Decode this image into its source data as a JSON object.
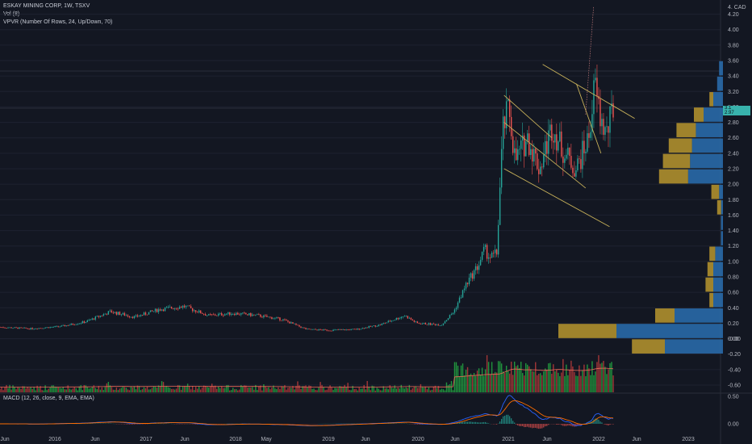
{
  "header": {
    "symbol_line": "ESKAY MINING CORP, 1W, TSXV",
    "vol_line": "Vol (8)",
    "vpvr_line": "VPVR (Number Of Rows, 24, Up/Down, 70)",
    "macd_line": "MACD (12, 26, close, 9, EMA, EMA)",
    "currency_label": "4. CAD"
  },
  "price_tag": {
    "line1": "3.1",
    "line2": "2.97"
  },
  "colors": {
    "background": "#131722",
    "up": "#26a69a",
    "down": "#ef5350",
    "vol_up": "#22a340",
    "vol_down": "#b23a3a",
    "vpvr_up": "#2a6fb0",
    "vpvr_down": "#b8962e",
    "trend": "#c9b25a",
    "macd": "#2962ff",
    "signal": "#ff6d00",
    "hist_up": "#26a69a",
    "hist_down": "#ef5350"
  },
  "chart_data": {
    "type": "candlestick",
    "title": "ESKAY MINING CORP, 1W, TSXV",
    "y_axis": {
      "ticks": [
        "4.20",
        "4.00",
        "3.80",
        "3.60",
        "3.40",
        "3.20",
        "3.00",
        "2.80",
        "2.60",
        "2.40",
        "2.20",
        "2.00",
        "1.80",
        "1.60",
        "1.40",
        "1.20",
        "1.00",
        "0.80",
        "0.60",
        "0.40",
        "0.20",
        "0.00",
        "-0.00",
        "-0.20",
        "-0.40",
        "-0.60"
      ],
      "range": [
        -0.6,
        4.3
      ]
    },
    "x_axis": {
      "ticks": [
        "Jun",
        "2016",
        "Jun",
        "2017",
        "Jun",
        "2018",
        "May",
        "2019",
        "Jun",
        "2020",
        "Jun",
        "2021",
        "Jun",
        "2022",
        "Jun",
        "2023"
      ]
    },
    "price_keyframes": [
      {
        "t": 0.0,
        "p": 0.15
      },
      {
        "t": 0.05,
        "p": 0.13
      },
      {
        "t": 0.1,
        "p": 0.16
      },
      {
        "t": 0.14,
        "p": 0.22
      },
      {
        "t": 0.18,
        "p": 0.35
      },
      {
        "t": 0.22,
        "p": 0.28
      },
      {
        "t": 0.26,
        "p": 0.38
      },
      {
        "t": 0.3,
        "p": 0.42
      },
      {
        "t": 0.34,
        "p": 0.3
      },
      {
        "t": 0.38,
        "p": 0.33
      },
      {
        "t": 0.42,
        "p": 0.3
      },
      {
        "t": 0.46,
        "p": 0.25
      },
      {
        "t": 0.5,
        "p": 0.12
      },
      {
        "t": 0.54,
        "p": 0.11
      },
      {
        "t": 0.58,
        "p": 0.12
      },
      {
        "t": 0.62,
        "p": 0.18
      },
      {
        "t": 0.66,
        "p": 0.3
      },
      {
        "t": 0.68,
        "p": 0.2
      },
      {
        "t": 0.72,
        "p": 0.18
      },
      {
        "t": 0.74,
        "p": 0.35
      },
      {
        "t": 0.76,
        "p": 0.7
      },
      {
        "t": 0.78,
        "p": 0.95
      },
      {
        "t": 0.79,
        "p": 1.15
      },
      {
        "t": 0.8,
        "p": 1.05
      },
      {
        "t": 0.81,
        "p": 1.1
      },
      {
        "t": 0.82,
        "p": 2.7
      },
      {
        "t": 0.83,
        "p": 3.0
      },
      {
        "t": 0.84,
        "p": 2.3
      },
      {
        "t": 0.86,
        "p": 2.6
      },
      {
        "t": 0.88,
        "p": 2.2
      },
      {
        "t": 0.9,
        "p": 2.75
      },
      {
        "t": 0.92,
        "p": 2.4
      },
      {
        "t": 0.94,
        "p": 2.2
      },
      {
        "t": 0.96,
        "p": 2.6
      },
      {
        "t": 0.97,
        "p": 3.3
      },
      {
        "t": 0.98,
        "p": 2.8
      },
      {
        "t": 0.99,
        "p": 2.65
      },
      {
        "t": 1.0,
        "p": 3.0
      }
    ],
    "vpvr_rows": [
      {
        "price": 3.5,
        "up": 0.02,
        "down": 0.0
      },
      {
        "price": 3.3,
        "up": 0.03,
        "down": 0.0
      },
      {
        "price": 3.1,
        "up": 0.05,
        "down": 0.02
      },
      {
        "price": 2.9,
        "up": 0.1,
        "down": 0.05
      },
      {
        "price": 2.7,
        "up": 0.14,
        "down": 0.1
      },
      {
        "price": 2.5,
        "up": 0.16,
        "down": 0.12
      },
      {
        "price": 2.3,
        "up": 0.17,
        "down": 0.14
      },
      {
        "price": 2.1,
        "up": 0.18,
        "down": 0.15
      },
      {
        "price": 1.9,
        "up": 0.02,
        "down": 0.04
      },
      {
        "price": 1.7,
        "up": 0.01,
        "down": 0.02
      },
      {
        "price": 1.5,
        "up": 0.01,
        "down": 0.0
      },
      {
        "price": 1.3,
        "up": 0.01,
        "down": 0.0
      },
      {
        "price": 1.1,
        "up": 0.04,
        "down": 0.03
      },
      {
        "price": 0.9,
        "up": 0.05,
        "down": 0.03
      },
      {
        "price": 0.7,
        "up": 0.05,
        "down": 0.04
      },
      {
        "price": 0.5,
        "up": 0.05,
        "down": 0.02
      },
      {
        "price": 0.3,
        "up": 0.25,
        "down": 0.1
      },
      {
        "price": 0.1,
        "up": 0.55,
        "down": 0.3
      },
      {
        "price": -0.1,
        "up": 0.3,
        "down": 0.17
      }
    ],
    "trendlines": [
      {
        "p1": [
          0.822,
          3.15
        ],
        "p2": [
          0.9,
          2.6
        ]
      },
      {
        "p1": [
          0.822,
          2.2
        ],
        "p2": [
          0.994,
          1.45
        ]
      },
      {
        "p1": [
          0.822,
          2.8
        ],
        "p2": [
          0.955,
          1.95
        ]
      },
      {
        "p1": [
          0.885,
          3.55
        ],
        "p2": [
          1.035,
          2.85
        ]
      },
      {
        "p1": [
          0.94,
          3.3
        ],
        "p2": [
          0.98,
          2.4
        ]
      }
    ],
    "macd_axis": {
      "ticks": [
        "0.50",
        "0.00"
      ]
    }
  }
}
